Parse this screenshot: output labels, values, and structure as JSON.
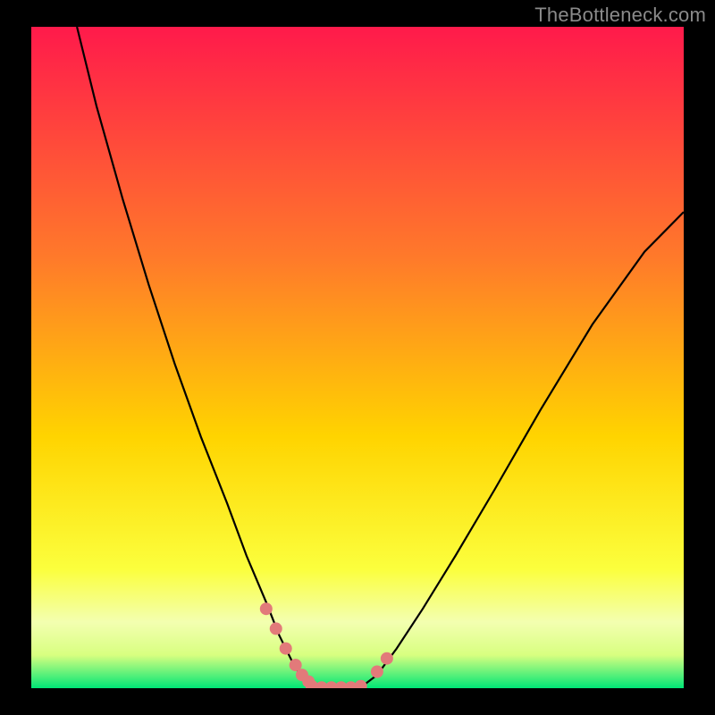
{
  "watermark": {
    "text": "TheBottleneck.com"
  },
  "colors": {
    "black": "#000000",
    "curve": "#000000",
    "marker_fill": "#e27a7a",
    "marker_stroke": "#d66",
    "grad_top": "#ff1a4b",
    "grad_mid1": "#ff7a2a",
    "grad_mid2": "#ffd400",
    "grad_mid3": "#f7ff66",
    "grad_band": "#d8ff80",
    "grad_green": "#00e676"
  },
  "chart_data": {
    "type": "line",
    "title": "",
    "xlabel": "",
    "ylabel": "",
    "xlim": [
      0,
      100
    ],
    "ylim": [
      0,
      100
    ],
    "series": [
      {
        "name": "bottleneck-curve-left",
        "x": [
          7,
          10,
          14,
          18,
          22,
          26,
          30,
          33,
          36,
          38,
          40,
          41.5,
          43
        ],
        "y": [
          100,
          88,
          74,
          61,
          49,
          38,
          28,
          20,
          13,
          8,
          4,
          1.5,
          0.5
        ]
      },
      {
        "name": "bottleneck-curve-flat",
        "x": [
          43,
          45,
          47,
          49,
          51
        ],
        "y": [
          0.5,
          0,
          0,
          0,
          0.5
        ]
      },
      {
        "name": "bottleneck-curve-right",
        "x": [
          51,
          53,
          56,
          60,
          65,
          71,
          78,
          86,
          94,
          100
        ],
        "y": [
          0.5,
          2,
          6,
          12,
          20,
          30,
          42,
          55,
          66,
          72
        ]
      }
    ],
    "markers": [
      {
        "name": "left-cluster",
        "x": [
          36,
          37.5,
          39,
          40.5,
          41.5,
          42.5
        ],
        "y": [
          12,
          9,
          6,
          3.5,
          2,
          1
        ],
        "r": [
          7,
          7,
          7,
          7,
          7,
          7
        ]
      },
      {
        "name": "floor-cluster",
        "x": [
          43,
          44.5,
          46,
          47.5,
          49,
          50.5
        ],
        "y": [
          0.3,
          0.1,
          0.1,
          0.1,
          0.1,
          0.3
        ],
        "r": [
          7,
          7,
          7,
          7,
          7,
          7
        ]
      },
      {
        "name": "right-cluster",
        "x": [
          53,
          54.5
        ],
        "y": [
          2.5,
          4.5
        ],
        "r": [
          7,
          7
        ]
      }
    ],
    "gradient_stops": [
      {
        "pct": 0,
        "note": "top"
      },
      {
        "pct": 35,
        "note": "orange"
      },
      {
        "pct": 65,
        "note": "yellow"
      },
      {
        "pct": 85,
        "note": "pale"
      },
      {
        "pct": 94,
        "note": "band-light"
      },
      {
        "pct": 100,
        "note": "green"
      }
    ]
  }
}
